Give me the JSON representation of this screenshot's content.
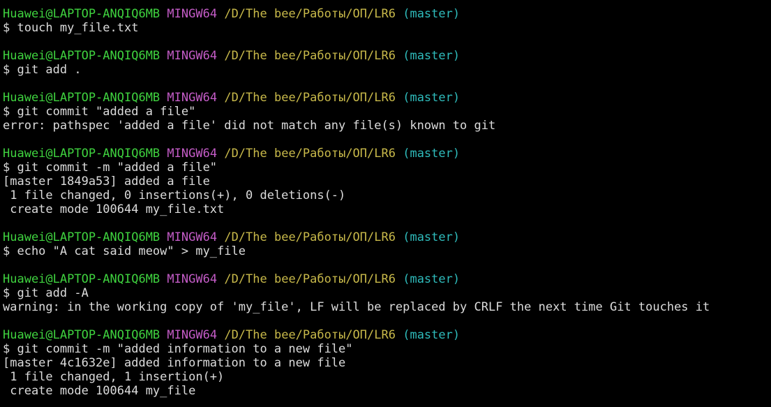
{
  "colors": {
    "background": "#000000",
    "user": "#3fd33f",
    "system": "#c45cc7",
    "path": "#c8b94a",
    "branch": "#2fbcbc",
    "text": "#dcdcdc"
  },
  "blocks": [
    {
      "prompt": {
        "user": "Huawei@LAPTOP-ANQIQ6MB",
        "system": "MINGW64",
        "path": "/D/The bee/Работы/ОП/LR6",
        "branch": "(master)"
      },
      "command": "$ touch my_file.txt",
      "output": []
    },
    {
      "prompt": {
        "user": "Huawei@LAPTOP-ANQIQ6MB",
        "system": "MINGW64",
        "path": "/D/The bee/Работы/ОП/LR6",
        "branch": "(master)"
      },
      "command": "$ git add .",
      "output": []
    },
    {
      "prompt": {
        "user": "Huawei@LAPTOP-ANQIQ6MB",
        "system": "MINGW64",
        "path": "/D/The bee/Работы/ОП/LR6",
        "branch": "(master)"
      },
      "command": "$ git commit \"added a file\"",
      "output": [
        "error: pathspec 'added a file' did not match any file(s) known to git"
      ]
    },
    {
      "prompt": {
        "user": "Huawei@LAPTOP-ANQIQ6MB",
        "system": "MINGW64",
        "path": "/D/The bee/Работы/ОП/LR6",
        "branch": "(master)"
      },
      "command": "$ git commit -m \"added a file\"",
      "output": [
        "[master 1849a53] added a file",
        " 1 file changed, 0 insertions(+), 0 deletions(-)",
        " create mode 100644 my_file.txt"
      ]
    },
    {
      "prompt": {
        "user": "Huawei@LAPTOP-ANQIQ6MB",
        "system": "MINGW64",
        "path": "/D/The bee/Работы/ОП/LR6",
        "branch": "(master)"
      },
      "command": "$ echo \"A cat said meow\" > my_file",
      "output": []
    },
    {
      "prompt": {
        "user": "Huawei@LAPTOP-ANQIQ6MB",
        "system": "MINGW64",
        "path": "/D/The bee/Работы/ОП/LR6",
        "branch": "(master)"
      },
      "command": "$ git add -A",
      "output": [
        "warning: in the working copy of 'my_file', LF will be replaced by CRLF the next time Git touches it"
      ]
    },
    {
      "prompt": {
        "user": "Huawei@LAPTOP-ANQIQ6MB",
        "system": "MINGW64",
        "path": "/D/The bee/Работы/ОП/LR6",
        "branch": "(master)"
      },
      "command": "$ git commit -m \"added information to a new file\"",
      "output": [
        "[master 4c1632e] added information to a new file",
        " 1 file changed, 1 insertion(+)",
        " create mode 100644 my_file"
      ]
    }
  ]
}
